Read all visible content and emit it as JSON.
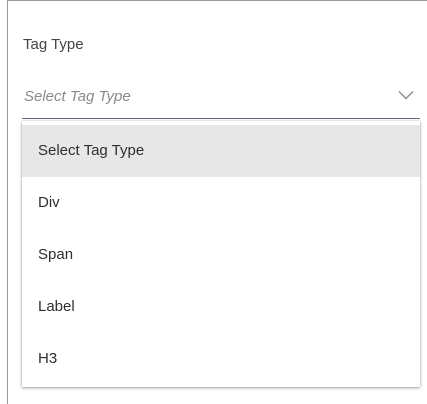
{
  "field": {
    "label": "Tag Type",
    "placeholder": "Select Tag Type"
  },
  "dropdown": {
    "options": [
      {
        "label": "Select Tag Type",
        "selected": true
      },
      {
        "label": "Div",
        "selected": false
      },
      {
        "label": "Span",
        "selected": false
      },
      {
        "label": "Label",
        "selected": false
      },
      {
        "label": "H3",
        "selected": false
      }
    ]
  },
  "icons": {
    "chevron": "chevron-down-icon"
  },
  "colors": {
    "selected_option_bg": "#e7e7e7",
    "underline": "#5f6a78",
    "placeholder": "#8a8a8a"
  }
}
